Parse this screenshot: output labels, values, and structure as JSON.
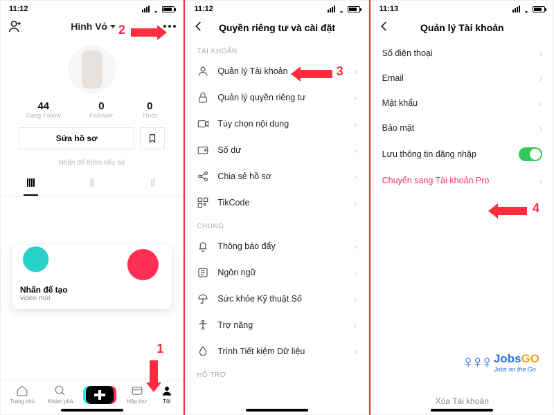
{
  "annotations": {
    "n1": "1",
    "n2": "2",
    "n3": "3",
    "n4": "4"
  },
  "screen1": {
    "time": "11:12",
    "username": "Hình Vỏ",
    "stats": [
      {
        "num": "44",
        "lbl": "Đang Follow"
      },
      {
        "num": "0",
        "lbl": "Follower"
      },
      {
        "num": "0",
        "lbl": "Thích"
      }
    ],
    "edit_label": "Sửa hồ sơ",
    "bio_placeholder": "Nhấn để thêm tiểu sử",
    "card_title": "Nhấn để tạo",
    "card_sub": "video mới",
    "nav": [
      {
        "lbl": "Trang chủ"
      },
      {
        "lbl": "Khám phá"
      },
      {
        "lbl": ""
      },
      {
        "lbl": "Hộp thư"
      },
      {
        "lbl": "Tôi"
      }
    ]
  },
  "screen2": {
    "time": "11:12",
    "title": "Quyền riêng tư và cài đặt",
    "section_account": "TÀI KHOẢN",
    "section_general": "CHUNG",
    "section_support": "HỖ TRỢ",
    "rows_account": [
      "Quản lý Tài khoản",
      "Quản lý quyền riêng tư",
      "Tùy chọn nội dung",
      "Số dư",
      "Chia sẻ hồ sơ",
      "TikCode"
    ],
    "rows_general": [
      "Thông báo đẩy",
      "Ngôn ngữ",
      "Sức khỏe Kỹ thuật Số",
      "Trợ năng",
      "Trình Tiết kiệm Dữ liệu"
    ]
  },
  "screen3": {
    "time": "11:13",
    "title": "Quản lý Tài khoản",
    "rows": [
      "Số điện thoại",
      "Email",
      "Mật khẩu",
      "Bảo mật"
    ],
    "toggle_row": "Lưu thông tin đăng nhập",
    "pro_row": "Chuyển sang Tài khoản Pro",
    "delete": "Xóa Tài khoản"
  },
  "logo": {
    "brand_a": "Jobs",
    "brand_b": "GO",
    "tagline": "Jobs on the Go"
  }
}
